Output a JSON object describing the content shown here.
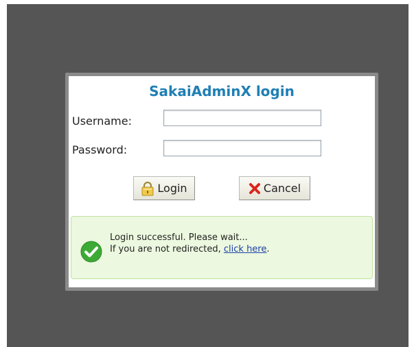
{
  "dialog": {
    "title": "SakaiAdminX login"
  },
  "form": {
    "username_label": "Username:",
    "username_value": "",
    "password_label": "Password:",
    "password_value": ""
  },
  "buttons": {
    "login_label": "Login",
    "login_icon": "lock-icon",
    "cancel_label": "Cancel",
    "cancel_icon": "x-icon"
  },
  "message": {
    "icon": "check-circle-icon",
    "line1": "Login successful. Please wait...",
    "line2_prefix": "If you are not redirected, ",
    "link_text": "click here",
    "line2_suffix": "."
  },
  "colors": {
    "title": "#1f7fb4",
    "success_bg": "#ecf8df",
    "success_border": "#bfe3a1",
    "check_green": "#3daa35",
    "cancel_red": "#d9261c",
    "overlay": "#555555"
  }
}
